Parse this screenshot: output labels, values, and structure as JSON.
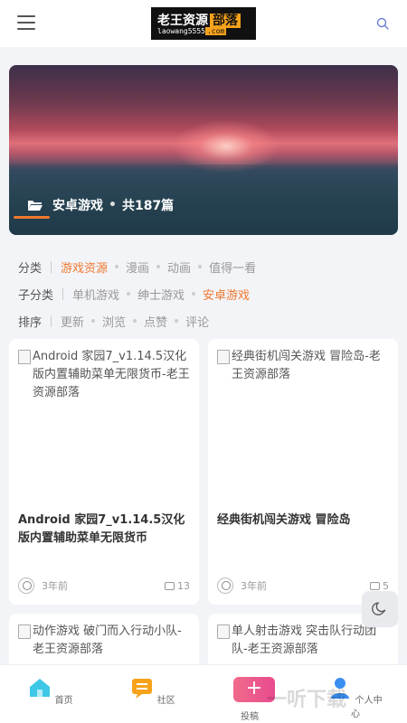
{
  "header": {
    "logo_top_main": "老王资源",
    "logo_top_accent": "部落",
    "logo_bottom_main": "laowang5555",
    "logo_bottom_accent": ".com",
    "menu_icon": "hamburger-icon",
    "search_icon": "search-icon"
  },
  "hero": {
    "category": "安卓游戏",
    "count": "共187篇",
    "accent_color": "#f0782e"
  },
  "filters": {
    "category": {
      "label": "分类",
      "items": [
        "游戏资源",
        "漫画",
        "动画",
        "值得一看"
      ],
      "active_index": 0
    },
    "subcategory": {
      "label": "子分类",
      "items": [
        "单机游戏",
        "绅士游戏",
        "安卓游戏"
      ],
      "active_index": 2
    },
    "sort": {
      "label": "排序",
      "items": [
        "更新",
        "浏览",
        "点赞",
        "评论"
      ]
    }
  },
  "cards": [
    {
      "image_alt": "Android 家园7_v1.14.5汉化版内置辅助菜单无限货币-老王资源部落",
      "title": "Android 家园7_v1.14.5汉化版内置辅助菜单无限货币",
      "time": "3年前",
      "comments": "13"
    },
    {
      "image_alt": "经典街机闯关游戏 冒险岛-老王资源部落",
      "title": "经典街机闯关游戏 冒险岛",
      "time": "3年前",
      "comments": "5"
    },
    {
      "image_alt": "动作游戏 破门而入行动小队-老王资源部落"
    },
    {
      "image_alt": "单人射击游戏 突击队行动团队-老王资源部落"
    }
  ],
  "bottom_nav": {
    "home": "首页",
    "community": "社区",
    "post": "投稿",
    "profile": "个人中心"
  },
  "watermark": "一听下载",
  "colors": {
    "accent": "#f0782e",
    "home_icon": "#3ec7e6",
    "community_icon": "#f7a21b",
    "post_button": "#e84c8f",
    "profile_icon": "#3a8ef0"
  }
}
